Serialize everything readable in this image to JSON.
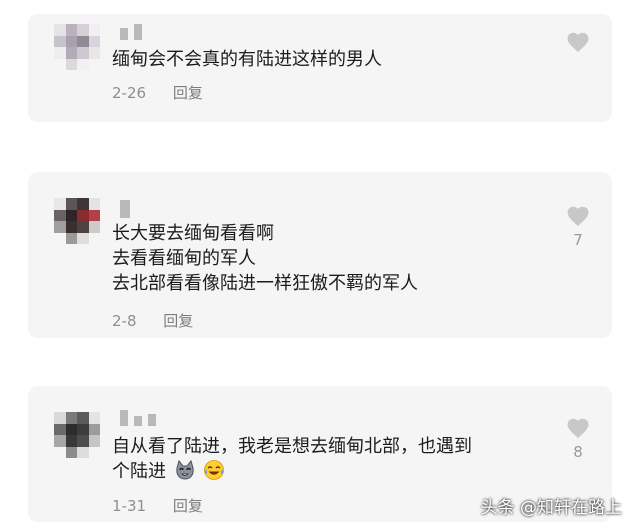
{
  "comments": [
    {
      "lines": [
        "缅甸会不会真的有陆进这样的男人"
      ],
      "date": "2-26",
      "reply_label": "回复",
      "like_count": ""
    },
    {
      "lines": [
        "长大要去缅甸看看啊",
        "去看看缅甸的军人",
        "去北部看看像陆进一样狂傲不羁的军人"
      ],
      "date": "2-8",
      "reply_label": "回复",
      "like_count": "7"
    },
    {
      "lines": [
        "自从看了陆进，我老是想去缅甸北部，也遇到",
        "个陆进"
      ],
      "date": "1-31",
      "reply_label": "回复",
      "like_count": "8"
    }
  ],
  "watermark": "头条 @知轩在路上",
  "icons": {
    "like": "heart-icon",
    "emoji_1": "cat-face-emoji-icon",
    "emoji_2": "laughing-tears-emoji-icon"
  },
  "colors": {
    "card_bg": "#f5f5f5",
    "text": "#1c1c1c",
    "meta": "#8f8f8f",
    "like": "#a8a8a8"
  }
}
